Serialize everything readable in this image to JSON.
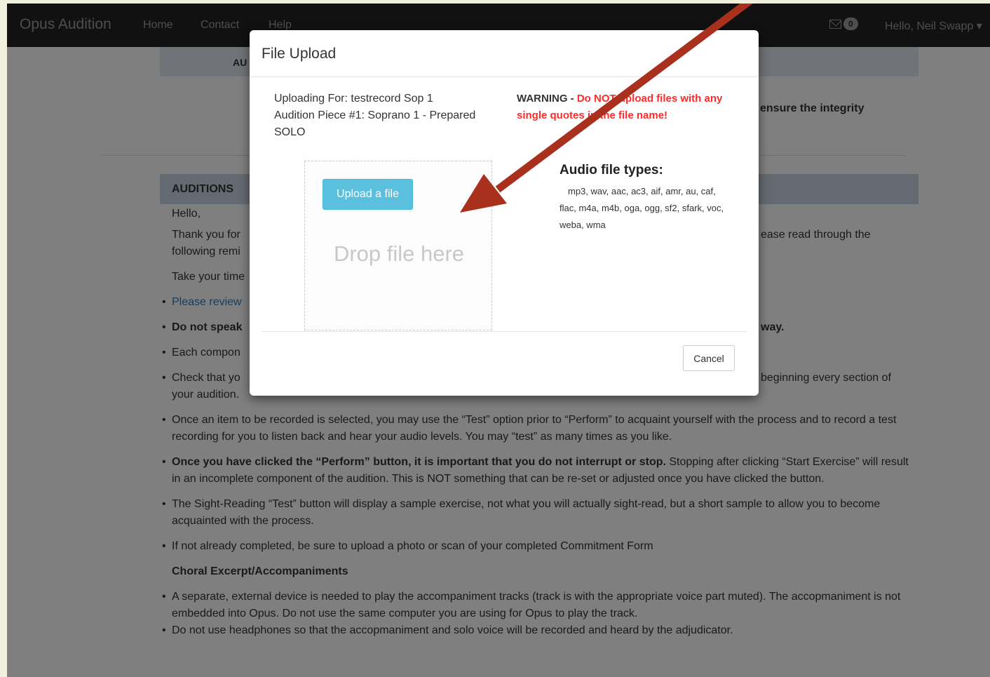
{
  "navbar": {
    "brand": "Opus Audition",
    "links": [
      "Home",
      "Contact",
      "Help"
    ],
    "mail_count": "0",
    "user_greeting": "Hello, Neil Swapp"
  },
  "page": {
    "partial_heading": "AU",
    "integrity_fragment": "ensure the integrity",
    "section_heading": "AUDITIONS",
    "greeting": "Hello,",
    "thank_you_line1": "Thank you for",
    "thank_you_right": "ease read through the",
    "thank_you_line2": "following remi",
    "take_time": "Take your time",
    "bullets": {
      "review": "Please review",
      "dont_speak": "Do not speak",
      "dont_speak_right": "way.",
      "each_component": "Each compon",
      "check_that": "Check that yo",
      "check_right": "beginning every section of",
      "check_line2": "your audition.",
      "once_selected": "Once an item to be recorded is selected, you may use the “Test” option prior to “Perform” to acquaint yourself with the process and to record a test recording for you to listen back and hear your audio levels. You may “test” as many times as you like.",
      "perform_bold": "Once you have clicked the “Perform” button, it is important that you do not interrupt or stop.",
      "perform_rest": " Stopping after clicking “Start Exercise” will result in an incomplete component of the audition. This is NOT something that can be re-set or adjusted once you have clicked the button.",
      "sight_reading": "The Sight-Reading “Test” button will display a sample exercise, not what you will actually sight-read, but a short sample to allow you to become acquainted with the process.",
      "upload_photo": "If not already completed, be sure to upload a photo or scan of your completed Commitment Form"
    },
    "choral_heading": "Choral Excerpt/Accompaniments",
    "choral_bullets": [
      "A separate, external device is needed to play the accompaniment tracks (track is with the appropriate voice part muted).  The accopmaniment is not embedded into Opus. Do not use the same computer you are using for Opus to play the track.",
      "Do not use headphones so that the accopmaniment and solo voice will be recorded and heard by the adjudicator."
    ]
  },
  "modal": {
    "title": "File Upload",
    "uploading_for": "Uploading For: testrecord Sop 1",
    "audition_piece": "Audition Piece #1: Soprano 1 - Prepared SOLO",
    "warning_label": "WARNING",
    "warning_dash": " - ",
    "warning_text": "Do NOT upload files with any single quotes in the file name!",
    "upload_button": "Upload a file",
    "drop_text": "Drop file here",
    "types_title": "Audio file types:",
    "types_lines": [
      "mp3, wav, aac, ac3, aif, amr, au, caf,",
      "flac, m4a, m4b, oga, ogg, sf2, sfark, voc,",
      "weba, wma"
    ],
    "cancel_button": "Cancel"
  },
  "colors": {
    "navbar_bg": "#222222",
    "info_button": "#5bc0de",
    "warning_red": "#ff2a2a",
    "arrow": "#a8301c"
  }
}
